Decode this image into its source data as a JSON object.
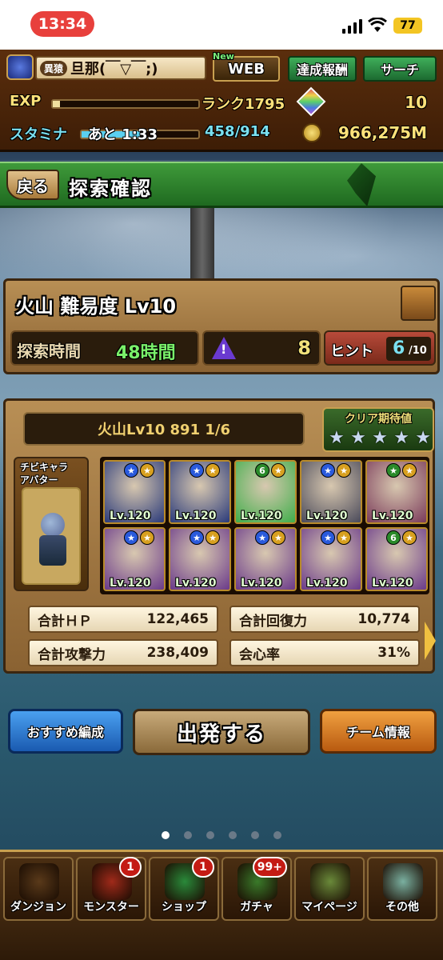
{
  "status_bar": {
    "time": "13:34",
    "battery": "77"
  },
  "header": {
    "rank_badge": "異猿",
    "player_name": "旦那(￣▽￣;)",
    "new_tag": "New",
    "web_button": "WEB",
    "achievement_button": "達成報酬",
    "search_button": "サーチ",
    "exp_label": "EXP",
    "rank_label": "ランク1795",
    "stamina_label": "スタミナ",
    "stamina_timer": "あと 1:33",
    "stamina_value": "458/914",
    "magic_stones": "10",
    "coins": "966,275M",
    "exp_fill": 0.05,
    "stamina_fill": 0.5
  },
  "title_bar": {
    "back_button": "戻る",
    "title": "探索確認"
  },
  "quest": {
    "title": "火山 難易度 Lv10",
    "time_label": "探索時間",
    "time_value": "48時間",
    "danger_value": "8",
    "hint_label": "ヒント",
    "hint_value": "6",
    "hint_total": "/10"
  },
  "team": {
    "name": "火山Lv10 891 1/6",
    "clear_label": "クリア期待値",
    "stars": 5,
    "avatar_label_1": "チビキャラ",
    "avatar_label_2": "アバター",
    "monsters": [
      {
        "lv": "Lv.120",
        "color": "#2a3a7a",
        "badge": "★",
        "badge_color": "#2a5adc"
      },
      {
        "lv": "Lv.120",
        "color": "#2a3a7a",
        "badge": "★",
        "badge_color": "#2a5adc"
      },
      {
        "lv": "Lv.120",
        "color": "#3fae4a",
        "badge": "6",
        "badge_color": "#2a8a2a"
      },
      {
        "lv": "Lv.120",
        "color": "#4a4a5a",
        "badge": "★",
        "badge_color": "#2a5adc"
      },
      {
        "lv": "Lv.120",
        "color": "#7a3a5a",
        "badge": "★",
        "badge_color": "#2a8a2a"
      },
      {
        "lv": "Lv.120",
        "color": "#6a3a8a",
        "badge": "★",
        "badge_color": "#2a5adc"
      },
      {
        "lv": "Lv.120",
        "color": "#6a3a8a",
        "badge": "★",
        "badge_color": "#2a5adc"
      },
      {
        "lv": "Lv.120",
        "color": "#6a3a8a",
        "badge": "★",
        "badge_color": "#2a5adc"
      },
      {
        "lv": "Lv.120",
        "color": "#6a3a8a",
        "badge": "★",
        "badge_color": "#2a5adc"
      },
      {
        "lv": "Lv.120",
        "color": "#6a3a8a",
        "badge": "6",
        "badge_color": "#2a8a2a"
      }
    ],
    "stats": {
      "hp_label": "合計ＨＰ",
      "hp_value": "122,465",
      "rcv_label": "合計回復力",
      "rcv_value": "10,774",
      "atk_label": "合計攻撃力",
      "atk_value": "238,409",
      "crit_label": "会心率",
      "crit_value": "31%"
    }
  },
  "actions": {
    "recommend_button": "おすすめ編成",
    "depart_button": "出発する",
    "team_info_button": "チーム情報"
  },
  "nav": [
    {
      "label": "ダンジョン",
      "badge": ""
    },
    {
      "label": "モンスター",
      "badge": "1"
    },
    {
      "label": "ショップ",
      "badge": "1"
    },
    {
      "label": "ガチャ",
      "badge": "99+"
    },
    {
      "label": "マイページ",
      "badge": ""
    },
    {
      "label": "その他",
      "badge": ""
    }
  ],
  "page_indicator": {
    "count": 6,
    "active": 0
  }
}
